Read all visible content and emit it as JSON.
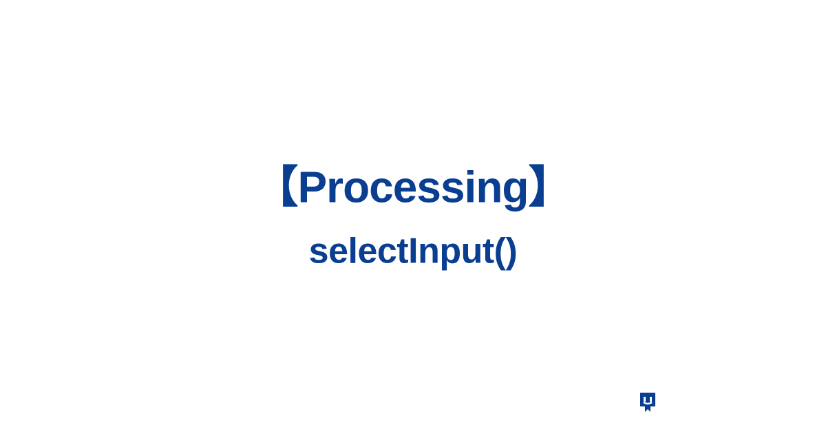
{
  "main": {
    "title": "【Processing】",
    "subtitle": "selectInput()"
  },
  "colors": {
    "text": "#0a3e91",
    "background": "#ffffff"
  }
}
